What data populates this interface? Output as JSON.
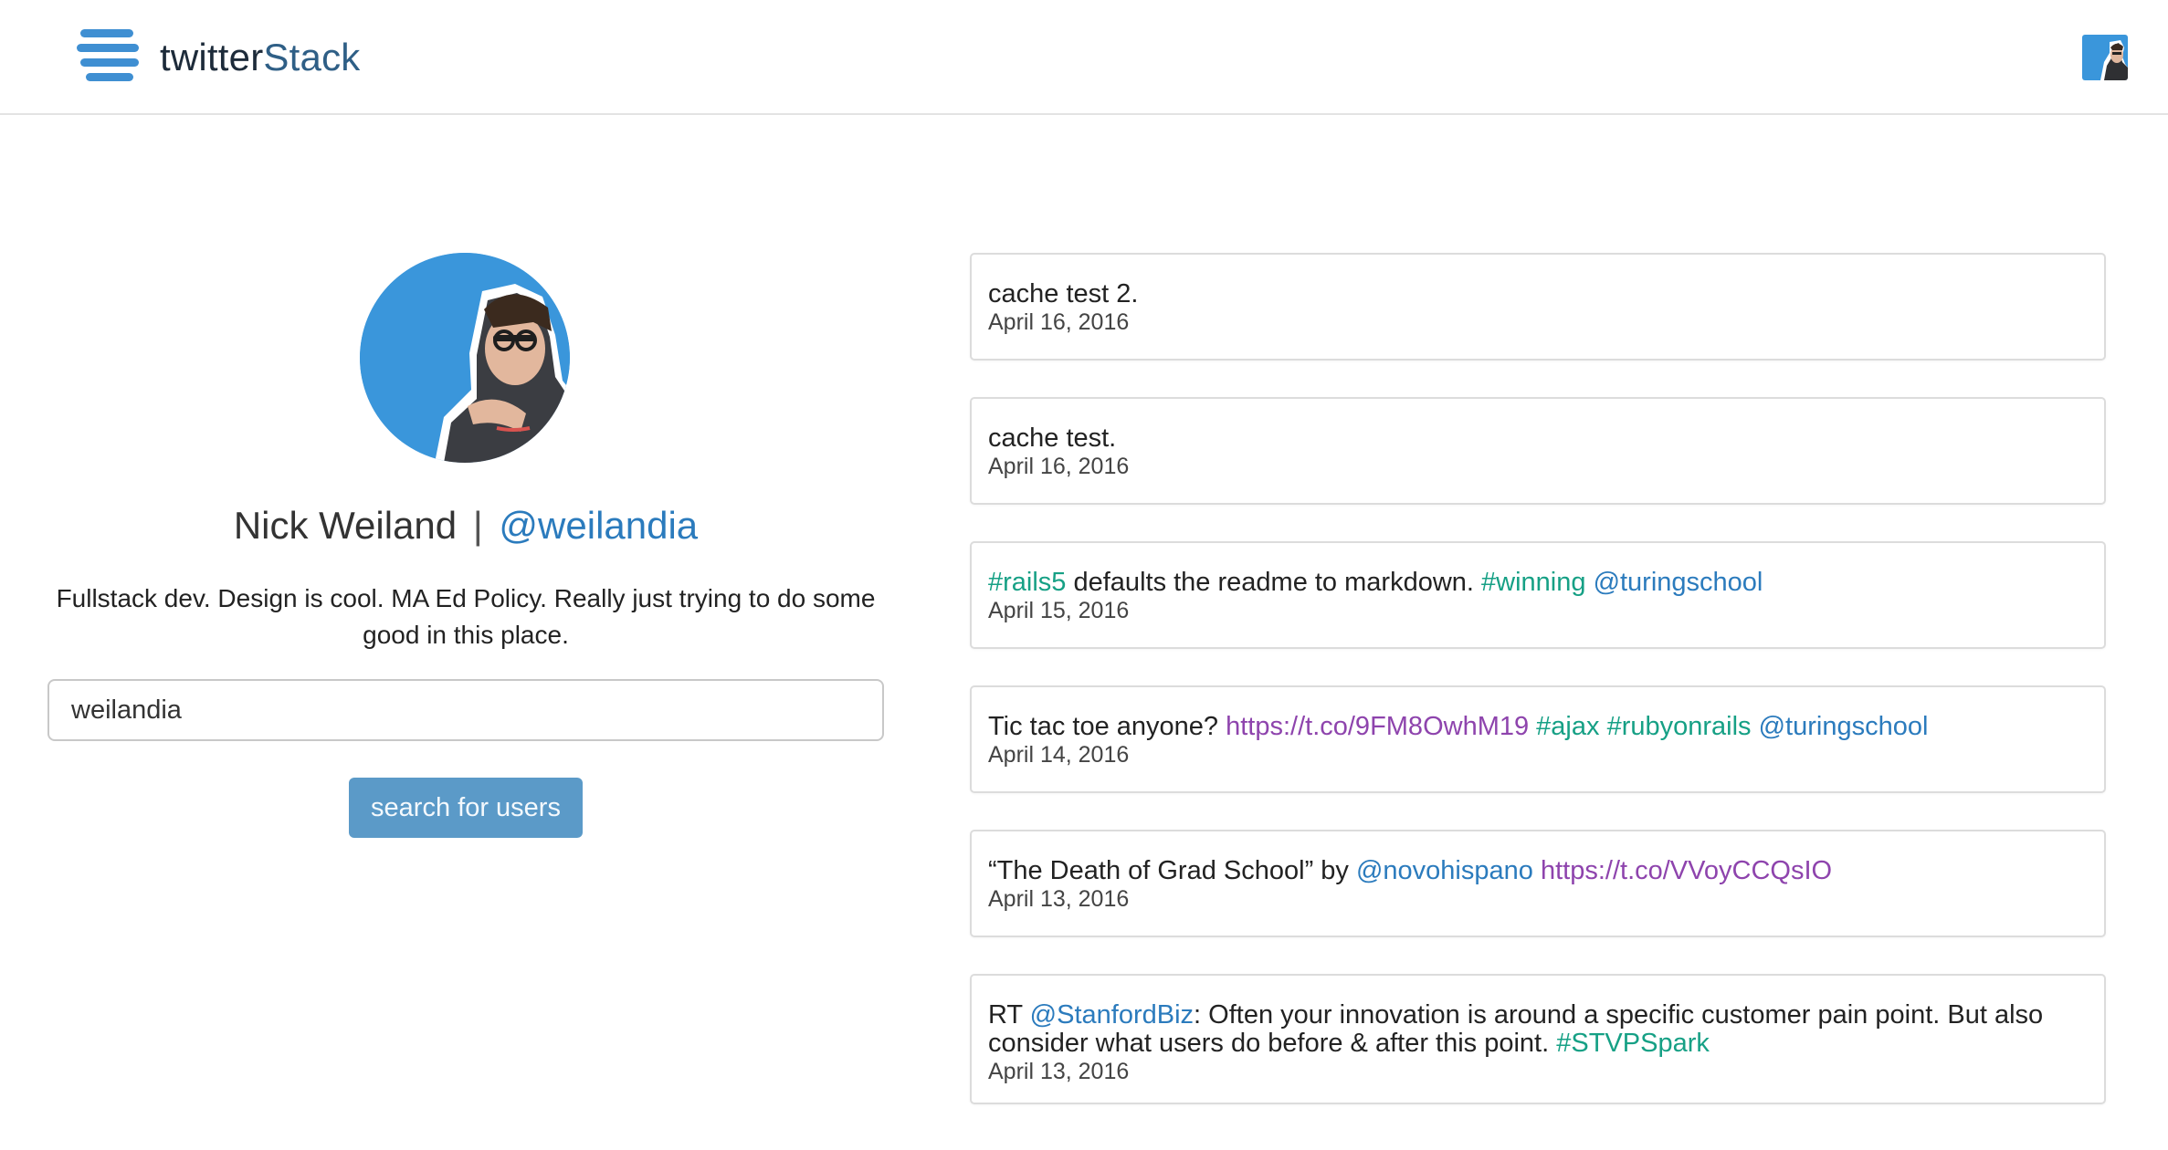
{
  "header": {
    "brand_primary": "twitter",
    "brand_secondary": "Stack",
    "logo_icon": "hamburger-logo-icon",
    "avatar_icon": "user-avatar-icon"
  },
  "profile": {
    "name": "Nick Weiland",
    "separator": "|",
    "handle": "@weilandia",
    "bio": "Fullstack dev. Design is cool. MA Ed Policy. Really just trying to do some good in this place.",
    "avatar_color": "#3a96db"
  },
  "search": {
    "value": "weilandia",
    "placeholder": "",
    "button_label": "search for users"
  },
  "colors": {
    "accent": "#3a96db",
    "hashtag": "#16a085",
    "mention": "#2b7bbd",
    "link": "#8e44ad",
    "button": "#5b9ac8"
  },
  "tweets": [
    {
      "segments": [
        {
          "type": "text",
          "text": "cache test 2."
        }
      ],
      "date": "April 16, 2016"
    },
    {
      "segments": [
        {
          "type": "text",
          "text": "cache test."
        }
      ],
      "date": "April 16, 2016"
    },
    {
      "segments": [
        {
          "type": "hashtag",
          "text": "#rails5"
        },
        {
          "type": "text",
          "text": " defaults the readme to markdown. "
        },
        {
          "type": "hashtag",
          "text": "#winning"
        },
        {
          "type": "text",
          "text": " "
        },
        {
          "type": "mention",
          "text": "@turingschool"
        }
      ],
      "date": "April 15, 2016"
    },
    {
      "segments": [
        {
          "type": "text",
          "text": "Tic tac toe anyone? "
        },
        {
          "type": "link",
          "text": "https://t.co/9FM8OwhM19"
        },
        {
          "type": "text",
          "text": " "
        },
        {
          "type": "hashtag",
          "text": "#ajax"
        },
        {
          "type": "text",
          "text": " "
        },
        {
          "type": "hashtag",
          "text": "#rubyonrails"
        },
        {
          "type": "text",
          "text": " "
        },
        {
          "type": "mention",
          "text": "@turingschool"
        }
      ],
      "date": "April 14, 2016"
    },
    {
      "segments": [
        {
          "type": "text",
          "text": "“The Death of Grad School” by "
        },
        {
          "type": "mention",
          "text": "@novohispano"
        },
        {
          "type": "text",
          "text": " "
        },
        {
          "type": "link",
          "text": "https://t.co/VVoyCCQsIO"
        }
      ],
      "date": "April 13, 2016"
    },
    {
      "segments": [
        {
          "type": "text",
          "text": "RT "
        },
        {
          "type": "mention",
          "text": "@StanfordBiz"
        },
        {
          "type": "text",
          "text": ": Often your innovation is around a specific customer pain point. But also consider what users do before & after this point. "
        },
        {
          "type": "hashtag",
          "text": "#STVPSpark"
        }
      ],
      "date": "April 13, 2016"
    }
  ]
}
